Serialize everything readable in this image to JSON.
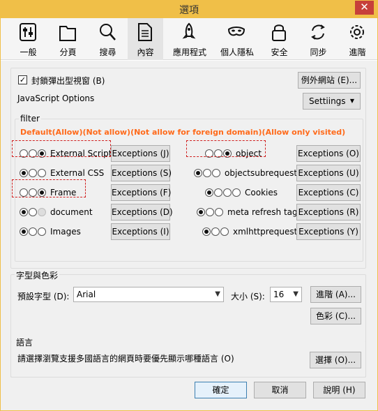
{
  "window": {
    "title": "選項",
    "close_label": "✕"
  },
  "tabs": [
    {
      "label": "一般",
      "icon": "toggles-icon"
    },
    {
      "label": "分頁",
      "icon": "folder-tab-icon"
    },
    {
      "label": "搜尋",
      "icon": "search-icon"
    },
    {
      "label": "內容",
      "icon": "document-icon",
      "active": true
    },
    {
      "label": "應用程式",
      "icon": "rocket-icon"
    },
    {
      "label": "個人隱私",
      "icon": "mask-icon"
    },
    {
      "label": "安全",
      "icon": "lock-icon"
    },
    {
      "label": "同步",
      "icon": "sync-icon"
    },
    {
      "label": "進階",
      "icon": "gear-icon"
    }
  ],
  "content": {
    "block_popups": {
      "label": "封鎖彈出型視窗 (B)",
      "checked": true
    },
    "exceptions_site_label": "例外網站 (E)...",
    "js_options_label": "JavaScript Options",
    "settings_label": "Settiings",
    "filter": {
      "title": "filter",
      "legend_note": "Default(Allow)(Not allow)(Not allow for foreign domain)(Allow only visited)",
      "rows_left": [
        {
          "name": "External Script",
          "states": [
            0,
            0,
            1
          ],
          "exceptions": "Exceptions (J)"
        },
        {
          "name": "External CSS",
          "states": [
            1,
            0,
            0
          ],
          "exceptions": "Exceptions (S)"
        },
        {
          "name": "Frame",
          "states": [
            0,
            0,
            1
          ],
          "exceptions": "Exceptions (F)"
        },
        {
          "name": "document",
          "states": [
            1,
            0,
            2
          ],
          "exceptions": "Exceptions (D)"
        },
        {
          "name": "Images",
          "states": [
            1,
            0,
            0
          ],
          "exceptions": "Exceptions (I)"
        }
      ],
      "rows_right": [
        {
          "name": "object",
          "states": [
            0,
            0,
            1
          ],
          "exceptions": "Exceptions (O)"
        },
        {
          "name": "objectsubrequest",
          "states": [
            1,
            0,
            0
          ],
          "exceptions": "Exceptions (U)"
        },
        {
          "name": "Cookies",
          "states": [
            1,
            0,
            0,
            0
          ],
          "exceptions": "Exceptions (C)"
        },
        {
          "name": "meta refresh tag",
          "states": [
            1,
            0,
            0
          ],
          "exceptions": "Exceptions (R)"
        },
        {
          "name": "xmlhttprequest",
          "states": [
            1,
            0,
            0
          ],
          "exceptions": "Exceptions (Y)"
        }
      ]
    },
    "fonts": {
      "title": "字型與色彩",
      "default_font_label": "預設字型 (D):",
      "font_value": "Arial",
      "size_label": "大小 (S):",
      "size_value": "16",
      "advanced_label": "進階 (A)...",
      "colors_label": "色彩 (C)..."
    },
    "language": {
      "title": "語言",
      "description": "請選擇瀏覽支援多國語言的網頁時要優先顯示哪種語言 (O)",
      "choose_label": "選擇 (O)..."
    }
  },
  "footer": {
    "ok": "確定",
    "cancel": "取消",
    "help": "說明 (H)"
  },
  "colors": {
    "titlebar": "#f0bf48",
    "close": "#c7403a",
    "annotation": "#ff6a1a",
    "dashed_box": "#d02020"
  }
}
